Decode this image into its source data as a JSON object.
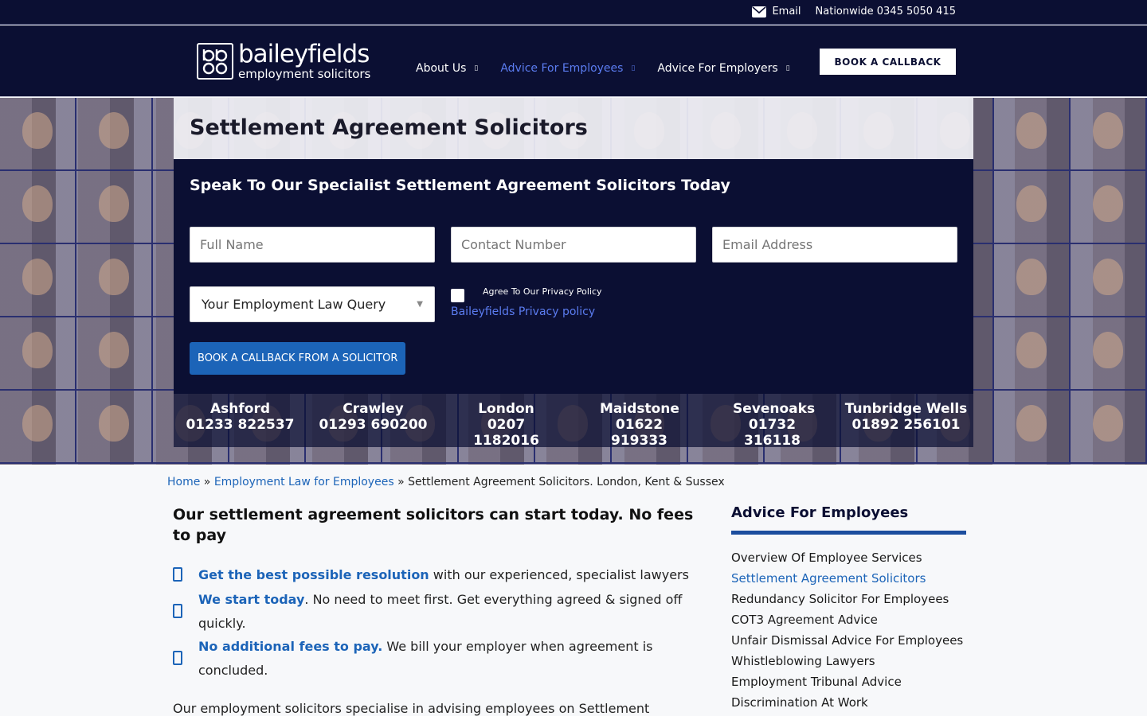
{
  "topbar": {
    "email_label": "Email",
    "phone_label": "Nationwide 0345 5050 415"
  },
  "header": {
    "logo_big": "baileyfields",
    "logo_small": "employment solicitors",
    "nav": [
      {
        "label": "About Us"
      },
      {
        "label": "Advice For Employees"
      },
      {
        "label": "Advice For Employers"
      }
    ],
    "callback_label": "BOOK A CALLBACK"
  },
  "hero": {
    "title": "Settlement Agreement Solicitors",
    "form_heading": "Speak To Our Specialist Settlement Agreement Solicitors Today",
    "name_placeholder": "Full Name",
    "phone_placeholder": "Contact Number",
    "email_placeholder": "Email Address",
    "query_select": "Your Employment Law Query",
    "privacy_label": "Agree To Our Privacy Policy",
    "privacy_link": "Baileyfields Privacy policy",
    "submit_label": "BOOK A CALLBACK FROM A SOLICITOR"
  },
  "offices": [
    {
      "name": "Ashford",
      "phone": "01233 822537"
    },
    {
      "name": "Crawley",
      "phone": "01293 690200"
    },
    {
      "name": "London",
      "phone": "0207 1182016"
    },
    {
      "name": "Maidstone",
      "phone": "01622 919333"
    },
    {
      "name": "Sevenoaks",
      "phone": "01732 316118"
    },
    {
      "name": "Tunbridge Wells",
      "phone": "01892 256101"
    }
  ],
  "breadcrumb": {
    "home": "Home",
    "sep": "»",
    "parent": "Employment Law for Employees",
    "current": "Settlement Agreement Solicitors. London, Kent & Sussex"
  },
  "main": {
    "title": "Our settlement agreement solicitors can start today. No fees to pay",
    "bullets": [
      {
        "strong": "Get the best possible resolution",
        "rest": " with our experienced, specialist lawyers"
      },
      {
        "strong": "We start today",
        "rest": ". No need to meet first. Get everything agreed & signed off quickly."
      },
      {
        "strong": "No additional fees to pay.",
        "rest": " We bill your employer when agreement is concluded."
      }
    ],
    "intro": "Our employment solicitors specialise in advising employees on Settlement"
  },
  "sidebar": {
    "title": "Advice For Employees",
    "items": [
      "Overview Of Employee Services",
      "Settlement Agreement Solicitors",
      "Redundancy Solicitor For Employees",
      "COT3 Agreement Advice",
      "Unfair Dismissal Advice For Employees",
      "Whistleblowing Lawyers",
      "Employment Tribunal Advice",
      "Discrimination At Work"
    ]
  },
  "colors": {
    "navy": "#0b0f33",
    "accent_blue": "#1c64b8",
    "nav_active": "#5b7cf0"
  }
}
